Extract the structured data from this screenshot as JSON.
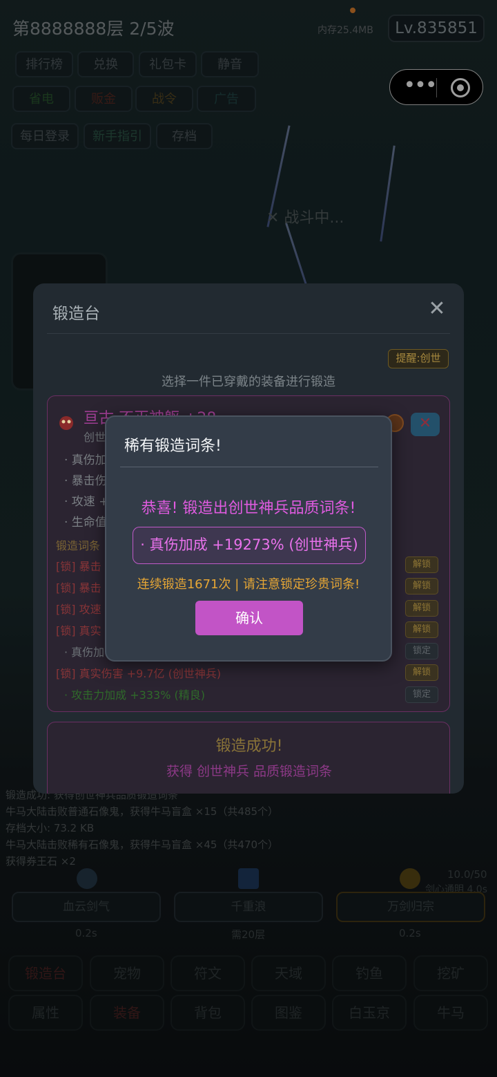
{
  "header": {
    "floor_title": "第8888888层  2/5波",
    "memory": "内存25.4MB",
    "level": "Lv.835851"
  },
  "capsule": {
    "more_icon": "more-dots-icon",
    "close_icon": "target-circle-icon",
    "more_label": "•••"
  },
  "top_buttons": {
    "row1": [
      "排行榜",
      "兑换",
      "礼包卡",
      "静音"
    ],
    "row2": [
      "省电",
      "贩金",
      "战令",
      "广告"
    ],
    "row3": [
      "每日登录",
      "新手指引",
      "存档"
    ]
  },
  "battle": {
    "status": "✕ 战斗中..."
  },
  "forge": {
    "title": "锻造台",
    "close": "✕",
    "reminder": "提醒:创世",
    "choose_hint": "选择一件已穿戴的装备进行锻造",
    "item_name": "亘古·不灭神躯 +28",
    "item_sub": "创世",
    "item_remove": "✕",
    "stats": [
      "· 真伤加",
      "· 暴击伤",
      "· 攻速 +",
      "· 生命值"
    ],
    "affix_header": "锻造词条",
    "affixes": [
      {
        "text": "[锁] 暴击",
        "button": "解锁"
      },
      {
        "text": "[锁] 暴击",
        "button": "解锁"
      },
      {
        "text": "[锁] 攻速",
        "button": "解锁"
      },
      {
        "text": "[锁] 真实",
        "button": "解锁"
      },
      {
        "text": "· 真伤加",
        "button": "锁定"
      },
      {
        "text": "[锁] 真实伤害 +9.7亿 (创世神兵)",
        "button": "解锁"
      },
      {
        "text": "· 攻击力加成 +333% (精良)",
        "button": "锁定"
      }
    ],
    "success_title": "锻造成功!",
    "success_sub": "获得 创世神兵 品质锻造词条"
  },
  "rare_dialog": {
    "title": "稀有锻造词条!",
    "congrats": "恭喜! 锻造出创世神兵品质词条!",
    "affix": "· 真伤加成 +19273% (创世神兵)",
    "note": "连续锻造1671次 | 请注意锁定珍贵词条!",
    "confirm": "确认"
  },
  "log": [
    "锻造成功: 获得创世神兵品质锻造词条",
    "牛马大陆击败普通石像鬼，获得牛马盲盒 ×15（共485个）",
    "存档大小: 73.2 KB",
    "牛马大陆击败稀有石像鬼，获得牛马盲盒 ×45（共470个）",
    "获得券王石 ×2"
  ],
  "skills": [
    {
      "name": "血云剑气",
      "cooldown": "0.2s"
    },
    {
      "name": "千重浪",
      "cooldown": "需20层"
    },
    {
      "name": "万剑归宗",
      "cooldown": "0.2s"
    }
  ],
  "skill_extra": {
    "count": "10.0/50",
    "sub": "剑心通明 4.0s"
  },
  "nav": {
    "row1": [
      "锻造台",
      "宠物",
      "符文",
      "天域",
      "钓鱼",
      "挖矿"
    ],
    "row2": [
      "属性",
      "装备",
      "背包",
      "图鉴",
      "白玉京",
      "牛马"
    ]
  },
  "colors": {
    "accent_magenta": "#c254c6",
    "gold": "#e6a635",
    "rare_text": "#e05be0"
  }
}
